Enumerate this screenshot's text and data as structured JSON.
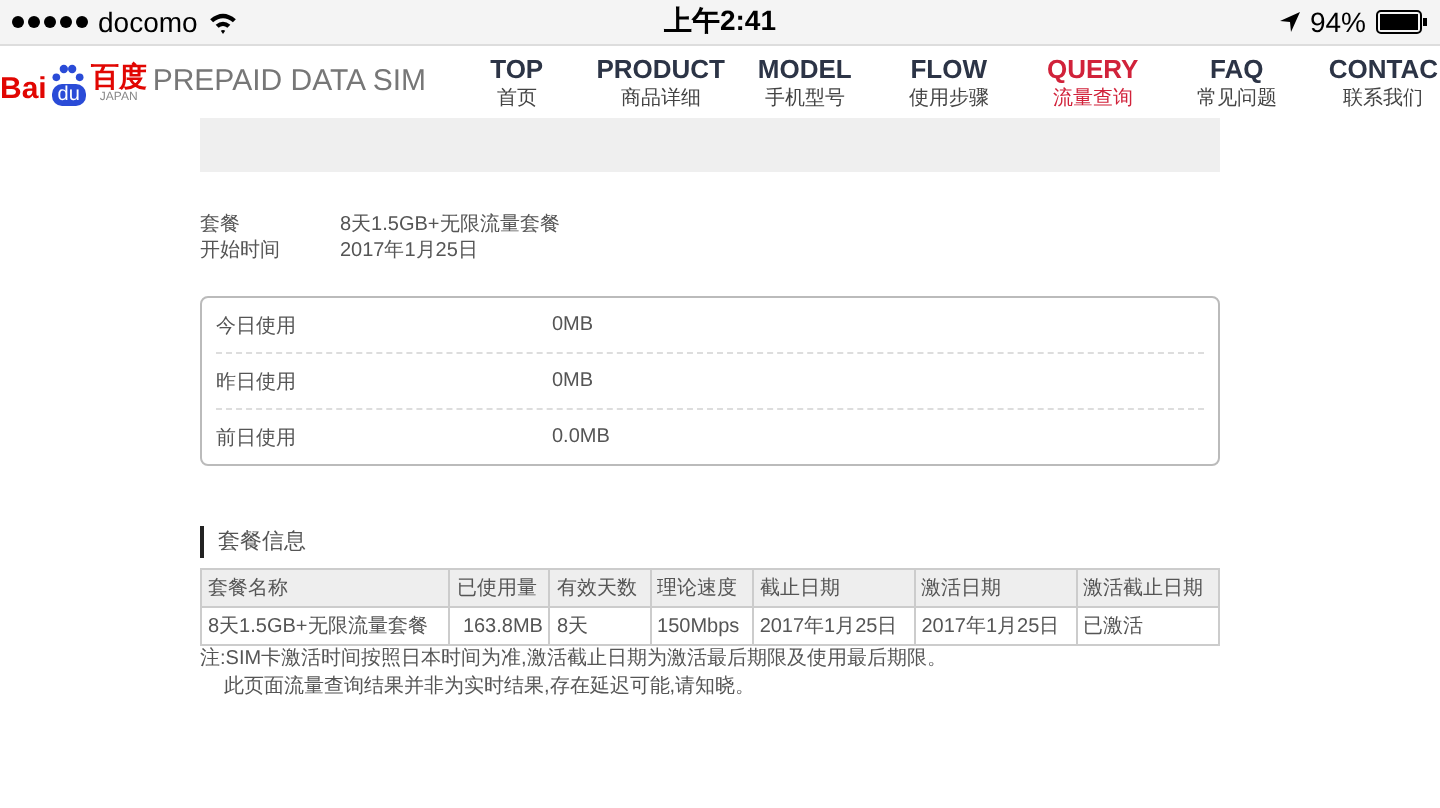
{
  "status_bar": {
    "carrier": "docomo",
    "time": "上午2:41",
    "battery": "94%"
  },
  "header": {
    "logo": {
      "part_1": "Bai",
      "part_2": "du",
      "part_3": "百度",
      "sub": "JAPAN",
      "product": "PREPAID DATA SIM"
    },
    "nav": [
      {
        "label": "TOP",
        "sub": "首页",
        "selected": false
      },
      {
        "label": "PRODUCT",
        "sub": "商品详细",
        "selected": false
      },
      {
        "label": "MODEL",
        "sub": "手机型号",
        "selected": false
      },
      {
        "label": "FLOW",
        "sub": "使用步骤",
        "selected": false
      },
      {
        "label": "QUERY",
        "sub": "流量查询",
        "selected": true
      },
      {
        "label": "FAQ",
        "sub": "常见问题",
        "selected": false
      },
      {
        "label": "CONTAC",
        "sub": "联系我们",
        "selected": false
      }
    ]
  },
  "plan": [
    {
      "label": "套餐",
      "value": "8天1.5GB+无限流量套餐"
    },
    {
      "label": "开始时间",
      "value": "2017年1月25日"
    }
  ],
  "usage": [
    {
      "label": "今日使用",
      "value": "0MB"
    },
    {
      "label": "昨日使用",
      "value": "0MB"
    },
    {
      "label": "前日使用",
      "value": "0.0MB"
    }
  ],
  "plan_info": {
    "title": "套餐信息",
    "columns": [
      "套餐名称",
      "已使用量",
      "有效天数",
      "理论速度",
      "截止日期",
      "激活日期",
      "激活截止日期"
    ],
    "rows": [
      [
        "8天1.5GB+无限流量套餐",
        "163.8MB",
        "8天",
        "150Mbps",
        "2017年1月25日",
        "2017年1月25日",
        "已激活"
      ]
    ]
  },
  "notes": [
    "注:SIM卡激活时间按照日本时间为准,激活截止日期为激活最后期限及使用最后期限。",
    "此页面流量查询结果并非为实时结果,存在延迟可能,请知晓。"
  ]
}
